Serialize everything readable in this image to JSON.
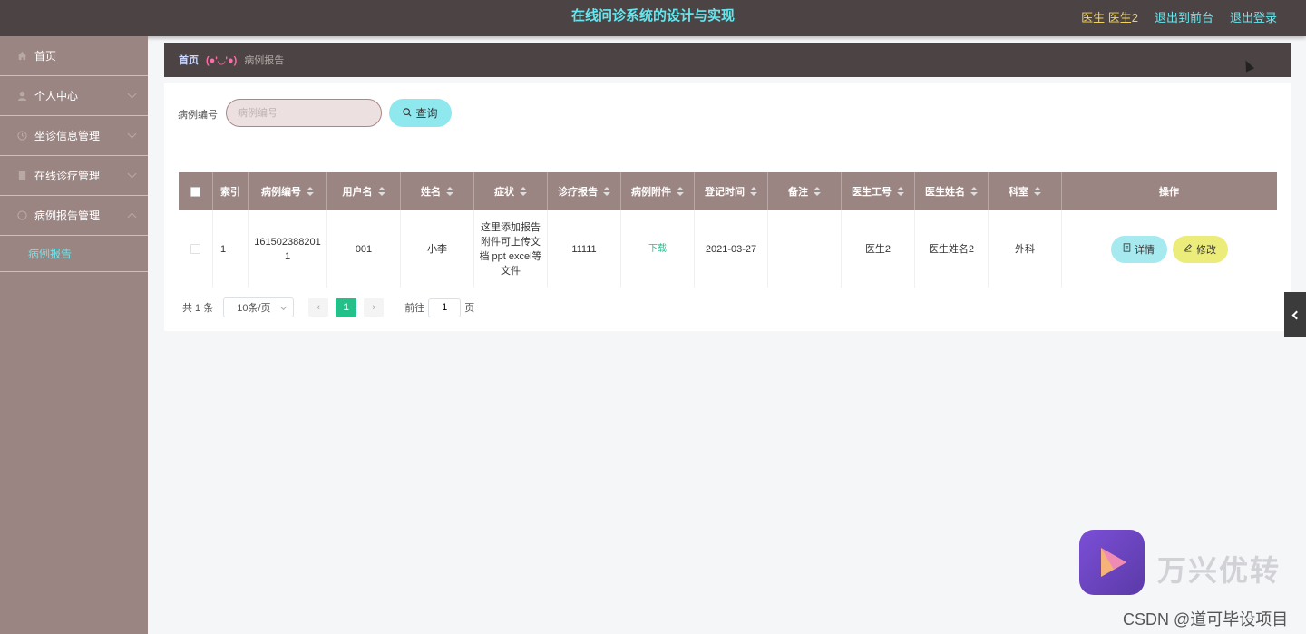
{
  "header": {
    "title": "在线问诊系统的设计与实现",
    "user_label": "医生 医生2",
    "back_to_front": "退出到前台",
    "logout": "退出登录"
  },
  "sidebar": {
    "items": [
      {
        "label": "首页",
        "icon": "home-icon"
      },
      {
        "label": "个人中心",
        "icon": "user-icon"
      },
      {
        "label": "坐诊信息管理",
        "icon": "clock-icon"
      },
      {
        "label": "在线诊疗管理",
        "icon": "building-icon"
      },
      {
        "label": "病例报告管理",
        "icon": "circle-icon"
      }
    ],
    "submenu": "病例报告"
  },
  "breadcrumb": {
    "home": "首页",
    "separator": "(●'◡'●)",
    "current": "病例报告"
  },
  "search": {
    "label": "病例编号",
    "placeholder": "病例编号",
    "button": "查询"
  },
  "table": {
    "headers": [
      "索引",
      "病例编号",
      "用户名",
      "姓名",
      "症状",
      "诊疗报告",
      "病例附件",
      "登记时间",
      "备注",
      "医生工号",
      "医生姓名",
      "科室",
      "操作"
    ],
    "rows": [
      {
        "index": "1",
        "case_no": "1615023882011",
        "username": "001",
        "name": "小李",
        "symptom": "这里添加报告 附件可上传文档 ppt excel等文件",
        "report": "11111",
        "attachment": "下载",
        "reg_time": "2021-03-27",
        "remark": "",
        "doctor_no": "医生2",
        "doctor_name": "医生姓名2",
        "department": "外科",
        "detail": "详情",
        "edit": "修改"
      }
    ]
  },
  "pagination": {
    "total": "共 1 条",
    "page_size": "10条/页",
    "current_page": "1",
    "goto_label": "前往",
    "goto_value": "1",
    "page_suffix": "页"
  },
  "watermark": {
    "brand": "万兴优转",
    "csdn": "CSDN @道可毕设项目"
  },
  "colors": {
    "topbar": "#4c4444",
    "sidebar": "#9b8582",
    "accent": "#66e6ee",
    "pager_active": "#23c08a"
  }
}
